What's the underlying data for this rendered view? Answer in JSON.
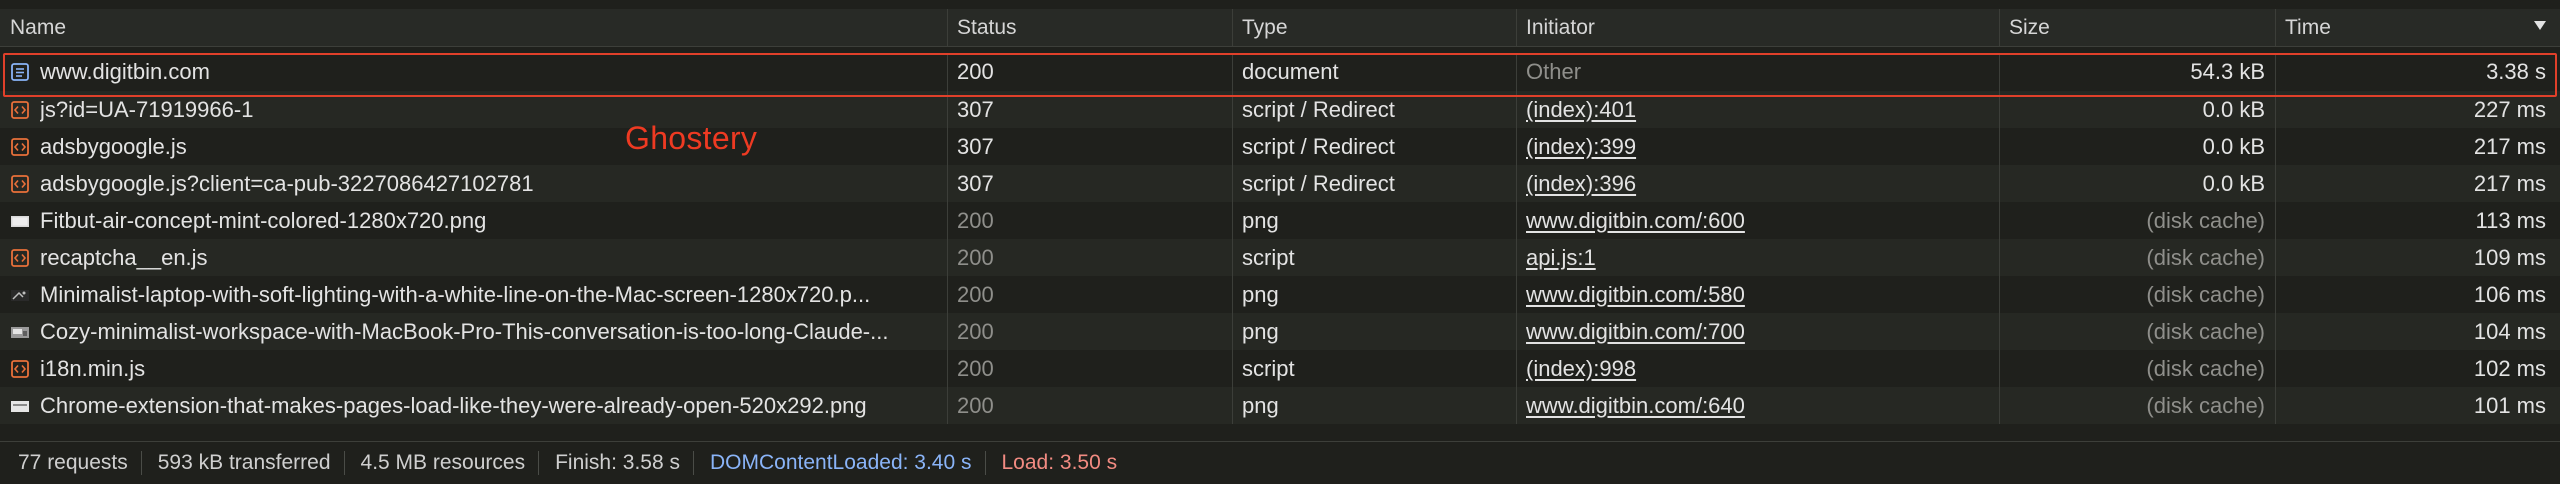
{
  "columns": {
    "name": "Name",
    "status": "Status",
    "type": "Type",
    "initiator": "Initiator",
    "size": "Size",
    "time": "Time"
  },
  "rows": [
    {
      "icon": "document-icon",
      "name": "www.digitbin.com",
      "status": "200",
      "type": "document",
      "initiator": "Other",
      "size": "54.3 kB",
      "time": "3.38 s"
    },
    {
      "icon": "script-icon",
      "name": "js?id=UA-71919966-1",
      "status": "307",
      "type": "script / Redirect",
      "initiator": "(index):401",
      "size": "0.0 kB",
      "time": "227 ms"
    },
    {
      "icon": "script-icon",
      "name": "adsbygoogle.js",
      "status": "307",
      "type": "script / Redirect",
      "initiator": "(index):399",
      "size": "0.0 kB",
      "time": "217 ms"
    },
    {
      "icon": "script-icon",
      "name": "adsbygoogle.js?client=ca-pub-3227086427102781",
      "status": "307",
      "type": "script / Redirect",
      "initiator": "(index):396",
      "size": "0.0 kB",
      "time": "217 ms"
    },
    {
      "icon": "image-icon",
      "name": "Fitbut-air-concept-mint-colored-1280x720.png",
      "status": "200",
      "type": "png",
      "initiator": "www.digitbin.com/:600",
      "size": "(disk cache)",
      "time": "113 ms"
    },
    {
      "icon": "script-icon",
      "name": "recaptcha__en.js",
      "status": "200",
      "type": "script",
      "initiator": "api.js:1",
      "size": "(disk cache)",
      "time": "109 ms"
    },
    {
      "icon": "image-icon",
      "name": "Minimalist-laptop-with-soft-lighting-with-a-white-line-on-the-Mac-screen-1280x720.p...",
      "status": "200",
      "type": "png",
      "initiator": "www.digitbin.com/:580",
      "size": "(disk cache)",
      "time": "106 ms"
    },
    {
      "icon": "image-icon",
      "name": "Cozy-minimalist-workspace-with-MacBook-Pro-This-conversation-is-too-long-Claude-...",
      "status": "200",
      "type": "png",
      "initiator": "www.digitbin.com/:700",
      "size": "(disk cache)",
      "time": "104 ms"
    },
    {
      "icon": "script-icon",
      "name": "i18n.min.js",
      "status": "200",
      "type": "script",
      "initiator": "(index):998",
      "size": "(disk cache)",
      "time": "102 ms"
    },
    {
      "icon": "image-icon",
      "name": "Chrome-extension-that-makes-pages-load-like-they-were-already-open-520x292.png",
      "status": "200",
      "type": "png",
      "initiator": "www.digitbin.com/:640",
      "size": "(disk cache)",
      "time": "101 ms"
    }
  ],
  "annotation": "Ghostery",
  "footer": {
    "requests": "77 requests",
    "transferred": "593 kB transferred",
    "resources": "4.5 MB resources",
    "finish": "Finish: 3.58 s",
    "dom_content_loaded": "DOMContentLoaded: 3.40 s",
    "load": "Load: 3.50 s"
  },
  "colors": {
    "background": "#1f201c",
    "row_alt": "#262823",
    "highlight_border": "#e0402a",
    "annotation": "#ee3a22",
    "dcl": "#8ab4f8",
    "load": "#f28b82",
    "script_icon": "#e8703a",
    "document_icon": "#8ab4f8"
  }
}
